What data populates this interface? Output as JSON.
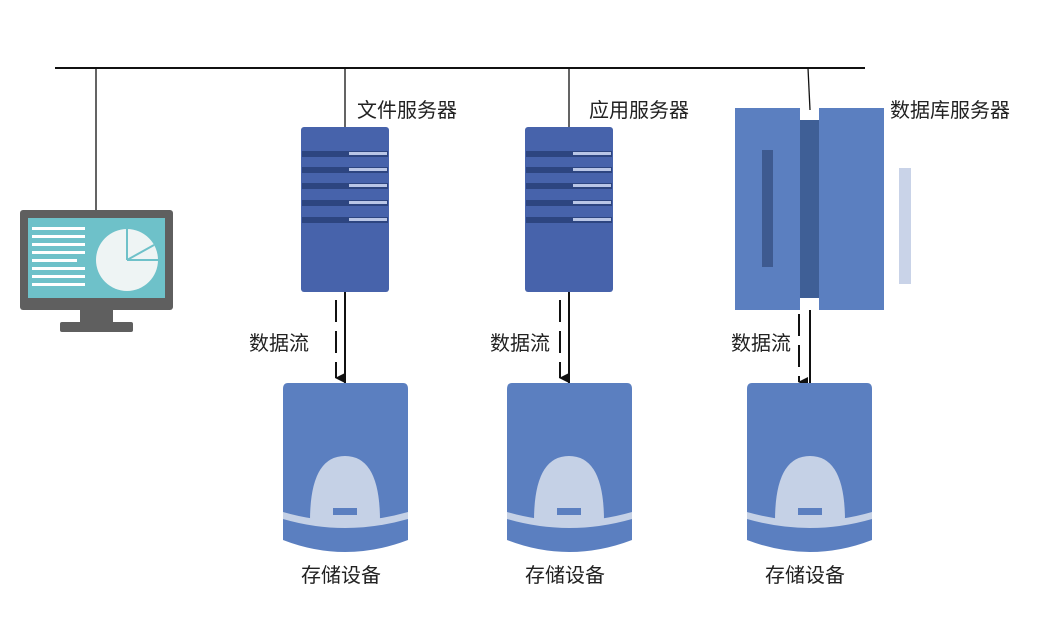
{
  "labels": {
    "file_server": "文件服务器",
    "app_server": "应用服务器",
    "db_server": "数据库服务器",
    "data_flow_1": "数据流",
    "data_flow_2": "数据流",
    "data_flow_3": "数据流",
    "storage_1": "存储设备",
    "storage_2": "存储设备",
    "storage_3": "存储设备"
  },
  "colors": {
    "server_blue": "#4763ab",
    "server_dark": "#2d4580",
    "storage_blue": "#5b7fc0",
    "storage_light": "#c5d1e6",
    "monitor_frame": "#5f5f5f",
    "monitor_screen": "#6ec1c9",
    "line": "#111111"
  },
  "icons": [
    "monitor-icon",
    "rack-server-icon",
    "database-server-icon",
    "storage-device-icon",
    "pie-chart-icon"
  ]
}
